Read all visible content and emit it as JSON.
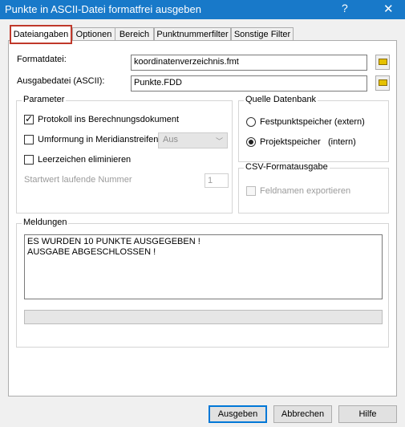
{
  "window": {
    "title": "Punkte in ASCII-Datei formatfrei ausgeben",
    "help_glyph": "?",
    "close_glyph": "✕"
  },
  "tabs": [
    {
      "label": "Dateiangaben",
      "active": true
    },
    {
      "label": "Optionen"
    },
    {
      "label": "Bereich"
    },
    {
      "label": "Punktnummerfilter"
    },
    {
      "label": "Sonstige Filter"
    }
  ],
  "files": {
    "format_label": "Formatdatei:",
    "format_value": "koordinatenverzeichnis.fmt",
    "output_label": "Ausgabedatei (ASCII):",
    "output_value": "Punkte.FDD",
    "browse_icon": "folder-icon"
  },
  "parameter": {
    "title": "Parameter",
    "protokoll_label": "Protokoll ins Berechnungsdokument",
    "protokoll_checked": true,
    "umformung_label": "Umformung in Meridianstreifen",
    "umformung_checked": false,
    "umformung_select": "Aus",
    "leerzeichen_label": "Leerzeichen eliminieren",
    "leerzeichen_checked": false,
    "startwert_label": "Startwert laufende Nummer",
    "startwert_value": "1"
  },
  "quelle": {
    "title": "Quelle Datenbank",
    "options": [
      {
        "label": "Festpunktspeicher (extern)",
        "selected": false
      },
      {
        "label": "Projektspeicher   (intern)",
        "selected": true
      }
    ]
  },
  "csv": {
    "title": "CSV-Formatausgabe",
    "feldnamen_label": "Feldnamen exportieren",
    "feldnamen_checked": false
  },
  "meldungen": {
    "title": "Meldungen",
    "lines": [
      "ES WURDEN 10 PUNKTE AUSGEGEBEN !",
      "AUSGABE ABGESCHLOSSEN !"
    ],
    "progress": 0
  },
  "buttons": {
    "ausgeben": "Ausgeben",
    "abbrechen": "Abbrechen",
    "hilfe": "Hilfe"
  },
  "colors": {
    "titlebar": "#1879c9",
    "tab_highlight": "#c0392b",
    "default_button": "#0078d7"
  }
}
